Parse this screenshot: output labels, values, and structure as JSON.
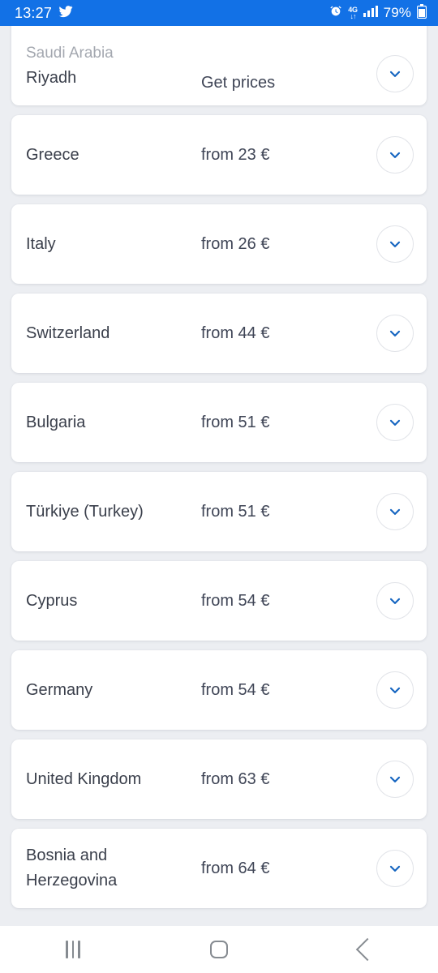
{
  "status_bar": {
    "time": "13:27",
    "app_icon": "twitter-icon",
    "alarm_icon": "alarm-clock-icon",
    "network_type": "4G",
    "network_arrows": "↓↑",
    "signal_icon": "signal-bars-icon",
    "battery_percent": "79%",
    "battery_icon": "battery-icon",
    "background_color": "#1271e6",
    "text_color": "#ffffff"
  },
  "theme": {
    "page_background": "#eceef2",
    "card_background": "#ffffff",
    "accent_blue": "#1565c0",
    "primary_text": "#3a3f4b",
    "muted_text": "#a4a8b0"
  },
  "list": {
    "expand_icon": "chevron-down-icon",
    "items": [
      {
        "country": "Saudi Arabia",
        "city": "Riyadh",
        "price": "Get prices",
        "clipped_top": true
      },
      {
        "country": "Greece",
        "city": "",
        "price": "from 23 €",
        "clipped_top": false
      },
      {
        "country": "Italy",
        "city": "",
        "price": "from 26 €",
        "clipped_top": false
      },
      {
        "country": "Switzerland",
        "city": "",
        "price": "from 44 €",
        "clipped_top": false
      },
      {
        "country": "Bulgaria",
        "city": "",
        "price": "from 51 €",
        "clipped_top": false
      },
      {
        "country": "Türkiye (Turkey)",
        "city": "",
        "price": "from 51 €",
        "clipped_top": false
      },
      {
        "country": "Cyprus",
        "city": "",
        "price": "from 54 €",
        "clipped_top": false
      },
      {
        "country": "Germany",
        "city": "",
        "price": "from 54 €",
        "clipped_top": false
      },
      {
        "country": "United Kingdom",
        "city": "",
        "price": "from 63 €",
        "clipped_top": false
      },
      {
        "country": "Bosnia and Herzegovina",
        "city": "",
        "price": "from 64 €",
        "clipped_top": false
      }
    ]
  },
  "nav_bar": {
    "recents_label": "Recents",
    "recents_icon": "recents-icon",
    "home_label": "Home",
    "home_icon": "home-icon",
    "back_label": "Back",
    "back_icon": "back-chevron-icon"
  }
}
